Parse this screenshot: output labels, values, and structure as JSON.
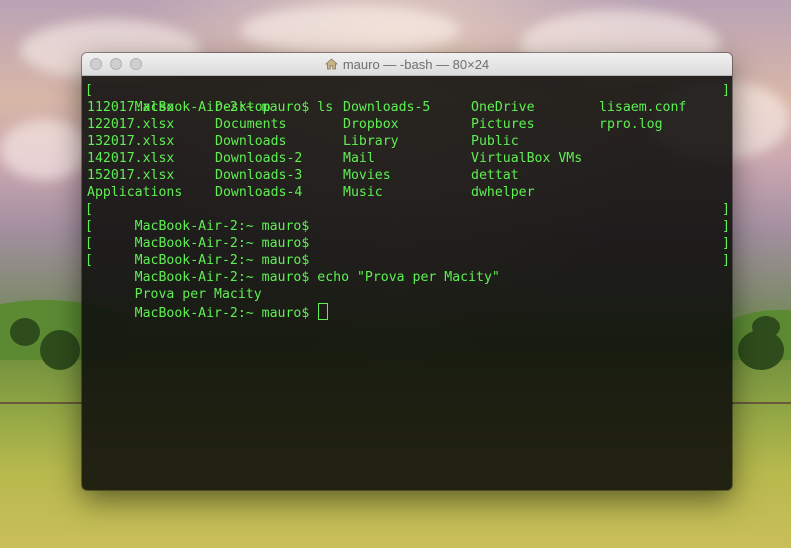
{
  "window": {
    "title": "mauro — -bash — 80×24",
    "title_icon": "home-icon"
  },
  "terminal": {
    "prompt": "MacBook-Air-2:~ mauro$",
    "cmd1": "ls",
    "ls_output": [
      [
        "112017.xlsx",
        "Desktop",
        "Downloads-5",
        "OneDrive",
        "lisaem.conf"
      ],
      [
        "122017.xlsx",
        "Documents",
        "Dropbox",
        "Pictures",
        "rpro.log"
      ],
      [
        "132017.xlsx",
        "Downloads",
        "Library",
        "Public",
        ""
      ],
      [
        "142017.xlsx",
        "Downloads-2",
        "Mail",
        "VirtualBox VMs",
        ""
      ],
      [
        "152017.xlsx",
        "Downloads-3",
        "Movies",
        "dettat",
        ""
      ],
      [
        "Applications",
        "Downloads-4",
        "Music",
        "dwhelper",
        ""
      ]
    ],
    "cmd_echo": "echo \"Prova per Macity\"",
    "echo_output": "Prova per Macity"
  },
  "colors": {
    "text": "#5ef052",
    "background": "#0c0c0a"
  }
}
